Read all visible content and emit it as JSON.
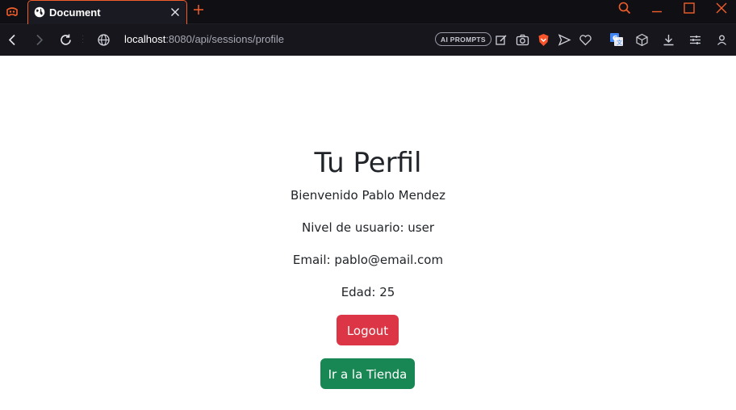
{
  "browser": {
    "tab": {
      "title": "Document"
    },
    "address": {
      "host": "localhost",
      "path": ":8080/api/sessions/profile"
    },
    "ai_prompts_label": "AI PROMPTS",
    "accent_color": "#f25d2c",
    "icons": [
      "opera-gx-icon",
      "globe-icon",
      "close-icon",
      "plus-icon",
      "search-icon",
      "minimize-icon",
      "maximize-icon",
      "back-icon",
      "forward-icon",
      "reload-icon",
      "site-info-icon",
      "edit-icon",
      "camera-icon",
      "brave-shield-icon",
      "send-icon",
      "heart-icon",
      "translate-icon",
      "cube-icon",
      "download-icon",
      "settings-icon",
      "profile-icon"
    ]
  },
  "profile": {
    "title": "Tu Perfil",
    "welcome": "Bienvenido Pablo Mendez",
    "level": "Nivel de usuario: user",
    "email": "Email: pablo@email.com",
    "age": "Edad: 25",
    "logout_label": "Logout",
    "store_label": "Ir a la Tienda",
    "colors": {
      "logout": "#dc3545",
      "store": "#198754",
      "text": "#212529"
    }
  }
}
